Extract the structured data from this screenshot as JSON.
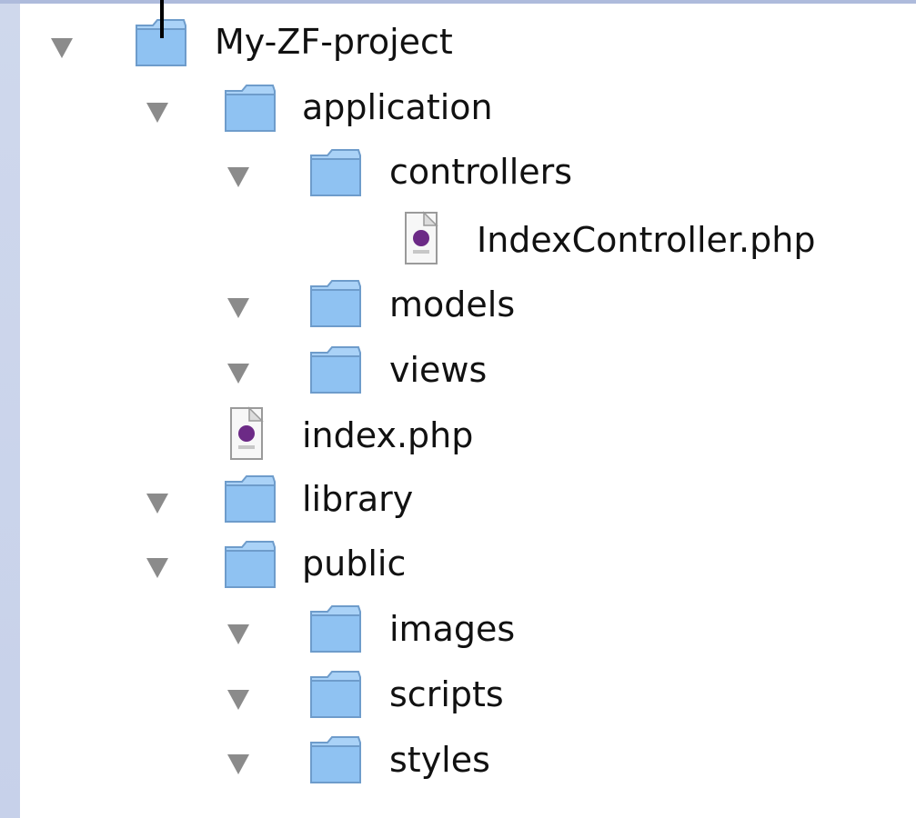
{
  "tree": {
    "root": {
      "label": "My-ZF-project",
      "icon": "folder-icon",
      "expanded": true
    },
    "items": [
      {
        "label": "application",
        "type": "folder",
        "depth": 1,
        "expanded": true
      },
      {
        "label": "controllers",
        "type": "folder",
        "depth": 2,
        "expanded": true
      },
      {
        "label": "IndexController.php",
        "type": "file",
        "depth": 3
      },
      {
        "label": "models",
        "type": "folder",
        "depth": 2,
        "expanded": true
      },
      {
        "label": "views",
        "type": "folder",
        "depth": 2,
        "expanded": true
      },
      {
        "label": "index.php",
        "type": "file",
        "depth": 2
      },
      {
        "label": "library",
        "type": "folder",
        "depth": 1,
        "expanded": true
      },
      {
        "label": "public",
        "type": "folder",
        "depth": 1,
        "expanded": true
      },
      {
        "label": "images",
        "type": "folder",
        "depth": 2,
        "expanded": true
      },
      {
        "label": "scripts",
        "type": "folder",
        "depth": 2,
        "expanded": true
      },
      {
        "label": "styles",
        "type": "folder",
        "depth": 2,
        "expanded": true
      }
    ]
  },
  "colors": {
    "folder_fill": "#8fc2f2",
    "disclosure": "#8b8b8b",
    "php_badge": "#6c2a86",
    "background": "#ffffff"
  }
}
